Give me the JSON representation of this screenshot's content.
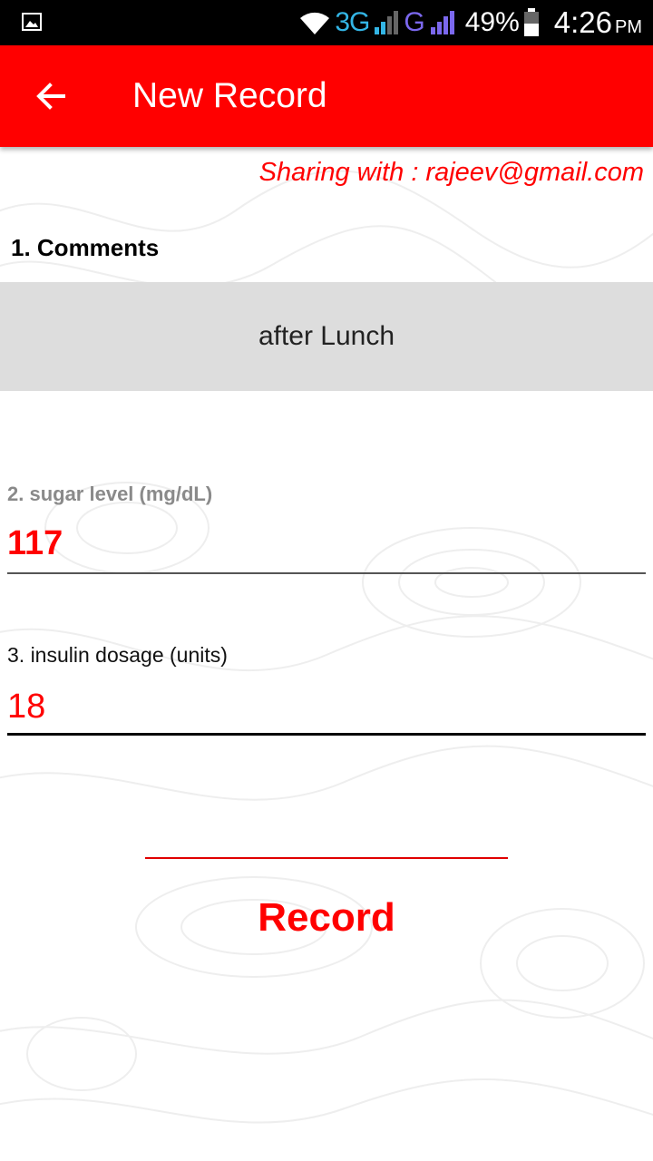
{
  "status_bar": {
    "network_3g": "3G",
    "network_g": "G",
    "battery": "49%",
    "time": "4:26",
    "ampm": "PM",
    "icons": [
      "image-icon",
      "wifi-icon",
      "signal-icon",
      "signal-icon",
      "battery-icon"
    ]
  },
  "app_bar": {
    "title": "New Record",
    "back_icon": "arrow-back-icon",
    "color": "#ff0000"
  },
  "form": {
    "sharing_text": "Sharing with : rajeev@gmail.com",
    "comments_label": "1. Comments",
    "comments_value": "after Lunch",
    "sugar_label": "2. sugar level (mg/dL)",
    "sugar_value": "117",
    "insulin_label": "3. insulin dosage (units)",
    "insulin_value": "18",
    "record_label": "Record"
  },
  "colors": {
    "accent": "#ff0000",
    "comment_bg": "#dddddd"
  }
}
